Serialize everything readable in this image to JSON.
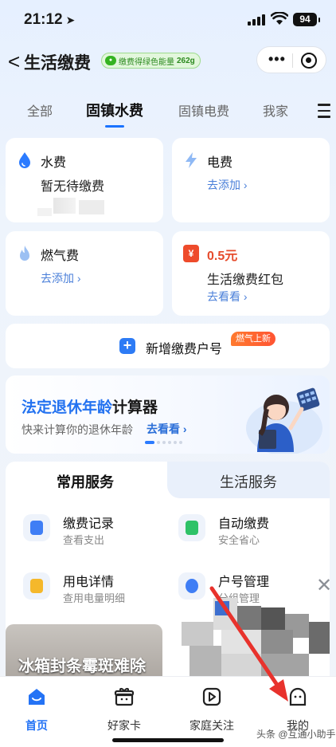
{
  "status": {
    "time": "21:12",
    "battery": "94"
  },
  "nav": {
    "back": "<",
    "title": "生活缴费",
    "energy_label": "缴费得绿色能量",
    "energy_value": "262g",
    "energy_icon": "leaf-icon"
  },
  "tabs": [
    "全部",
    "固镇水费",
    "固镇电费",
    "我家"
  ],
  "cards": {
    "water": {
      "title": "水费",
      "status": "暂无待缴费"
    },
    "electric": {
      "title": "电费",
      "action": "去添加 ›"
    },
    "gas": {
      "title": "燃气费",
      "action": "去添加 ›"
    },
    "redpacket": {
      "amount": "0.5元",
      "title": "生活缴费红包",
      "action": "去看看 ›",
      "icon_text": "¥"
    }
  },
  "new_account": {
    "label": "新增缴费户号",
    "badge": "燃气上新"
  },
  "banner": {
    "title_highlight": "法定退休年龄",
    "title_rest": "计算器",
    "subtitle": "快来计算你的退休年龄",
    "action": "去看看 ›"
  },
  "services": {
    "tab_common": "常用服务",
    "tab_life": "生活服务",
    "items": [
      {
        "name": "缴费记录",
        "desc": "查看支出"
      },
      {
        "name": "自动缴费",
        "desc": "安全省心"
      },
      {
        "name": "用电详情",
        "desc": "查用电量明细"
      },
      {
        "name": "户号管理",
        "desc": "分组管理"
      }
    ]
  },
  "ad": {
    "text": "冰箱封条霉斑难除",
    "close": "✕"
  },
  "tabbar": [
    "首页",
    "好家卡",
    "家庭关注",
    "我的"
  ],
  "watermark": "头条 @互通小助手",
  "colors": {
    "accent": "#2473f5",
    "price": "#e64b2c",
    "arrow": "#e8322c"
  }
}
